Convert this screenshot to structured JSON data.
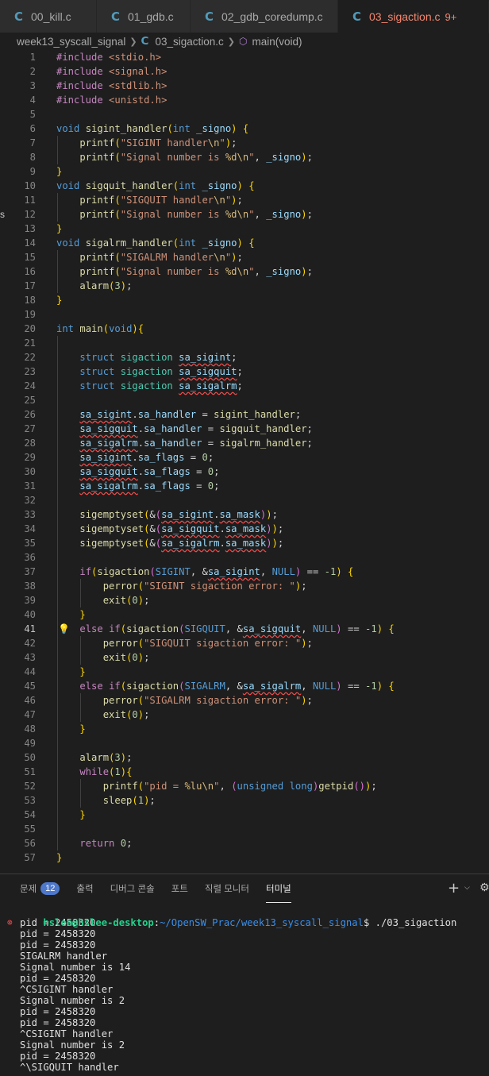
{
  "tabs": [
    {
      "icon": "c-file-icon",
      "label": "00_kill.c",
      "active": false,
      "badge": ""
    },
    {
      "icon": "c-file-icon",
      "label": "01_gdb.c",
      "active": false,
      "badge": ""
    },
    {
      "icon": "c-file-icon",
      "label": "02_gdb_coredump.c",
      "active": false,
      "badge": ""
    },
    {
      "icon": "c-file-icon",
      "label": "03_sigaction.c",
      "active": true,
      "badge": "9+"
    }
  ],
  "breadcrumb": {
    "folder": "week13_syscall_signal",
    "file": "03_sigaction.c",
    "symbol": "main(void)"
  },
  "editor": {
    "current_line": 41,
    "lines": [
      {
        "n": "1",
        "code": "#include <stdio.h>"
      },
      {
        "n": "2",
        "code": "#include <signal.h>"
      },
      {
        "n": "3",
        "code": "#include <stdlib.h>"
      },
      {
        "n": "4",
        "code": "#include <unistd.h>"
      },
      {
        "n": "5",
        "code": ""
      },
      {
        "n": "6",
        "code": "void sigint_handler(int _signo) {"
      },
      {
        "n": "7",
        "code": "    printf(\"SIGINT handler\\n\");"
      },
      {
        "n": "8",
        "code": "    printf(\"Signal number is %d\\n\", _signo);"
      },
      {
        "n": "9",
        "code": "}"
      },
      {
        "n": "10",
        "code": "void sigquit_handler(int _signo) {"
      },
      {
        "n": "11",
        "code": "    printf(\"SIGQUIT handler\\n\");"
      },
      {
        "n": "12",
        "code": "    printf(\"Signal number is %d\\n\", _signo);"
      },
      {
        "n": "13",
        "code": "}"
      },
      {
        "n": "14",
        "code": "void sigalrm_handler(int _signo) {"
      },
      {
        "n": "15",
        "code": "    printf(\"SIGALRM handler\\n\");"
      },
      {
        "n": "16",
        "code": "    printf(\"Signal number is %d\\n\", _signo);"
      },
      {
        "n": "17",
        "code": "    alarm(3);"
      },
      {
        "n": "18",
        "code": "}"
      },
      {
        "n": "19",
        "code": ""
      },
      {
        "n": "20",
        "code": "int main(void){"
      },
      {
        "n": "21",
        "code": ""
      },
      {
        "n": "22",
        "code": "    struct sigaction sa_sigint;"
      },
      {
        "n": "23",
        "code": "    struct sigaction sa_sigquit;"
      },
      {
        "n": "24",
        "code": "    struct sigaction sa_sigalrm;"
      },
      {
        "n": "25",
        "code": ""
      },
      {
        "n": "26",
        "code": "    sa_sigint.sa_handler = sigint_handler;"
      },
      {
        "n": "27",
        "code": "    sa_sigquit.sa_handler = sigquit_handler;"
      },
      {
        "n": "28",
        "code": "    sa_sigalrm.sa_handler = sigalrm_handler;"
      },
      {
        "n": "29",
        "code": "    sa_sigint.sa_flags = 0;"
      },
      {
        "n": "30",
        "code": "    sa_sigquit.sa_flags = 0;"
      },
      {
        "n": "31",
        "code": "    sa_sigalrm.sa_flags = 0;"
      },
      {
        "n": "32",
        "code": ""
      },
      {
        "n": "33",
        "code": "    sigemptyset(&(sa_sigint.sa_mask));"
      },
      {
        "n": "34",
        "code": "    sigemptyset(&(sa_sigquit.sa_mask));"
      },
      {
        "n": "35",
        "code": "    sigemptyset(&(sa_sigalrm.sa_mask));"
      },
      {
        "n": "36",
        "code": ""
      },
      {
        "n": "37",
        "code": "    if(sigaction(SIGINT, &sa_sigint, NULL) == -1) {"
      },
      {
        "n": "38",
        "code": "        perror(\"SIGINT sigaction error: \");"
      },
      {
        "n": "39",
        "code": "        exit(0);"
      },
      {
        "n": "40",
        "code": "    }"
      },
      {
        "n": "41",
        "code": "    else if(sigaction(SIGQUIT, &sa_sigquit, NULL) == -1) {"
      },
      {
        "n": "42",
        "code": "        perror(\"SIGQUIT sigaction error: \");"
      },
      {
        "n": "43",
        "code": "        exit(0);"
      },
      {
        "n": "44",
        "code": "    }"
      },
      {
        "n": "45",
        "code": "    else if(sigaction(SIGALRM, &sa_sigalrm, NULL) == -1) {"
      },
      {
        "n": "46",
        "code": "        perror(\"SIGALRM sigaction error: \");"
      },
      {
        "n": "47",
        "code": "        exit(0);"
      },
      {
        "n": "48",
        "code": "    }"
      },
      {
        "n": "49",
        "code": ""
      },
      {
        "n": "50",
        "code": "    alarm(3);"
      },
      {
        "n": "51",
        "code": "    while(1){"
      },
      {
        "n": "52",
        "code": "        printf(\"pid = %lu\\n\", (unsigned long)getpid());"
      },
      {
        "n": "53",
        "code": "        sleep(1);"
      },
      {
        "n": "54",
        "code": "    }"
      },
      {
        "n": "55",
        "code": ""
      },
      {
        "n": "56",
        "code": "    return 0;"
      },
      {
        "n": "57",
        "code": "}"
      }
    ]
  },
  "panel": {
    "tabs": [
      {
        "label": "문제",
        "badge": "12",
        "active": false
      },
      {
        "label": "출력",
        "badge": "",
        "active": false
      },
      {
        "label": "디버그 콘솔",
        "badge": "",
        "active": false
      },
      {
        "label": "포트",
        "badge": "",
        "active": false
      },
      {
        "label": "직렬 모니터",
        "badge": "",
        "active": false
      },
      {
        "label": "터미널",
        "badge": "",
        "active": true
      }
    ],
    "left_edge_char": "s"
  },
  "terminal": {
    "prompt_user": "hslee@hslee-desktop",
    "prompt_path": "~/OpenSW_Prac/week13_syscall_signal",
    "prompt_suffix": "$ ./03_sigaction",
    "output": [
      "pid = 2458320",
      "pid = 2458320",
      "pid = 2458320",
      "SIGALRM handler",
      "Signal number is 14",
      "pid = 2458320",
      "^CSIGINT handler",
      "Signal number is 2",
      "pid = 2458320",
      "pid = 2458320",
      "^CSIGINT handler",
      "Signal number is 2",
      "pid = 2458320",
      "^\\SIGQUIT handler"
    ]
  },
  "colors": {
    "accent": "#4d78cc",
    "error": "#f14c4c",
    "modified_tab": "#f48771",
    "c_icon": "#519aba"
  }
}
